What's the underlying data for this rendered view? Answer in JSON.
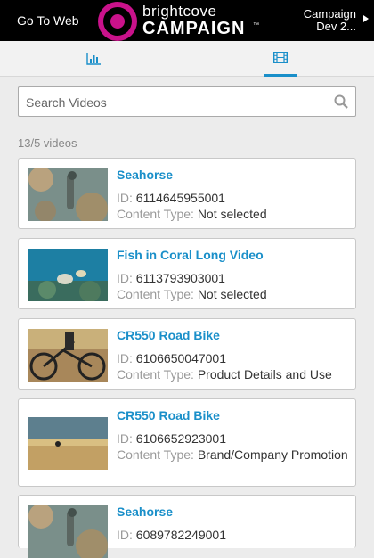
{
  "header": {
    "go_to_web": "Go To Web",
    "logo_brand": "brightcove",
    "logo_product": "CAMPAIGN",
    "logo_tm": "™",
    "account_line1": "Campaign",
    "account_line2": "Dev 2..."
  },
  "tabs": {
    "analytics_icon": "bar-chart-icon",
    "videos_icon": "film-icon",
    "active": "videos"
  },
  "search": {
    "placeholder": "Search Videos"
  },
  "list": {
    "count_label": "13/5 videos",
    "id_label": "ID:",
    "type_label": "Content Type:",
    "items": [
      {
        "title": "Seahorse",
        "id": "6114645955001",
        "content_type": "Not selected"
      },
      {
        "title": "Fish in Coral Long Video",
        "id": "6113793903001",
        "content_type": "Not selected"
      },
      {
        "title": "CR550 Road Bike",
        "id": "6106650047001",
        "content_type": "Product Details and Use"
      },
      {
        "title": "CR550 Road Bike",
        "id": "6106652923001",
        "content_type": "Brand/Company Promotion"
      },
      {
        "title": "Seahorse",
        "id": "6089782249001",
        "content_type": ""
      }
    ]
  },
  "colors": {
    "accent": "#1a8fc9",
    "brand_magenta": "#c9128b"
  }
}
